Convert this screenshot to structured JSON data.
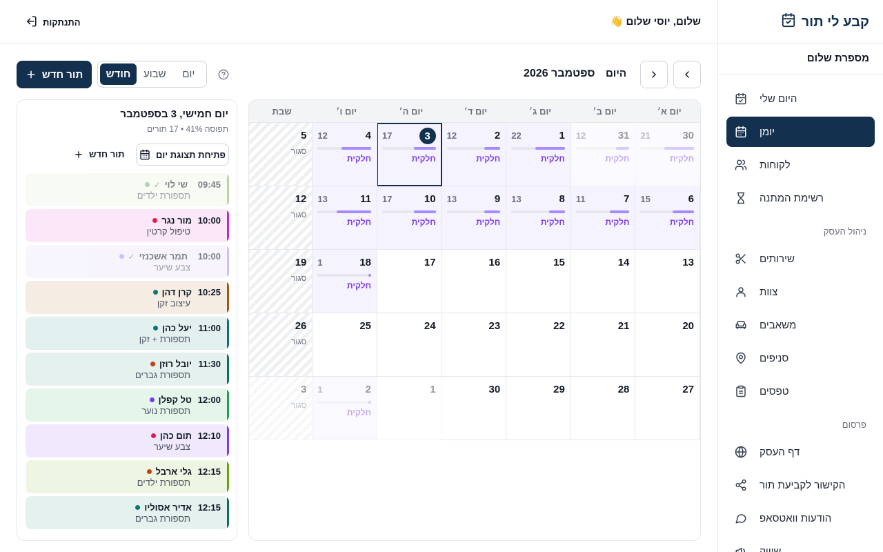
{
  "app": {
    "brand": "קבע לי תור",
    "salon_name": "מספרת שלום"
  },
  "header": {
    "greeting": "שלום, יוסי שלום 👋",
    "logout": "התנתקות"
  },
  "sidebar": {
    "items": [
      {
        "label": "היום שלי",
        "icon": "calendar-check-icon"
      },
      {
        "label": "יומן",
        "icon": "calendar-icon",
        "active": true
      },
      {
        "label": "לקוחות",
        "icon": "users-icon"
      },
      {
        "label": "רשימת המתנה",
        "icon": "hourglass-icon"
      }
    ],
    "section_business": "ניהול העסק",
    "business_items": [
      {
        "label": "שירותים",
        "icon": "scissors-icon"
      },
      {
        "label": "צוות",
        "icon": "user-icon"
      },
      {
        "label": "משאבים",
        "icon": "sofa-icon"
      },
      {
        "label": "סניפים",
        "icon": "map-pin-icon"
      },
      {
        "label": "טפסים",
        "icon": "clipboard-icon"
      }
    ],
    "section_publish": "פרסום",
    "publish_items": [
      {
        "label": "דף העסק",
        "icon": "globe-icon"
      },
      {
        "label": "הקישור לקביעת תור",
        "icon": "share-icon"
      },
      {
        "label": "הודעות וואטסאפ",
        "icon": "message-icon"
      },
      {
        "label": "שיווק",
        "icon": "megaphone-icon"
      }
    ]
  },
  "toolbar": {
    "today": "היום",
    "month_title": "ספטמבר 2026",
    "views": {
      "day": "יום",
      "week": "שבוע",
      "month": "חודש"
    },
    "active_view": "month",
    "new_appointment": "תור חדש"
  },
  "calendar": {
    "weekdays": [
      "יום א׳",
      "יום ב׳",
      "יום ג׳",
      "יום ד׳",
      "יום ה׳",
      "יום ו׳",
      "שבת"
    ],
    "partial_label": "חלקית",
    "closed_label": "סגור",
    "weeks": [
      [
        {
          "day": "30",
          "count": "21",
          "occupancy": 0.55,
          "partial": true,
          "other_month": true
        },
        {
          "day": "31",
          "count": "12",
          "occupancy": 0.25,
          "partial": true,
          "other_month": true
        },
        {
          "day": "1",
          "count": "22",
          "occupancy": 0.55,
          "partial": true
        },
        {
          "day": "2",
          "count": "12",
          "occupancy": 0.3,
          "partial": true
        },
        {
          "day": "3",
          "count": "17",
          "occupancy": 0.41,
          "partial": true,
          "today": true
        },
        {
          "day": "4",
          "count": "12",
          "occupancy": 0.55,
          "partial": true
        },
        {
          "day": "5",
          "closed": true
        }
      ],
      [
        {
          "day": "6",
          "count": "15",
          "occupancy": 0.4,
          "partial": true
        },
        {
          "day": "7",
          "count": "11",
          "occupancy": 0.36,
          "partial": true
        },
        {
          "day": "8",
          "count": "13",
          "occupancy": 0.3,
          "partial": true
        },
        {
          "day": "9",
          "count": "13",
          "occupancy": 0.3,
          "partial": true
        },
        {
          "day": "10",
          "count": "17",
          "occupancy": 0.41,
          "partial": true
        },
        {
          "day": "11",
          "count": "13",
          "occupancy": 0.65,
          "partial": true
        },
        {
          "day": "12",
          "closed": true
        }
      ],
      [
        {
          "day": "13"
        },
        {
          "day": "14"
        },
        {
          "day": "15"
        },
        {
          "day": "16"
        },
        {
          "day": "17"
        },
        {
          "day": "18",
          "count": "1",
          "occupancy": 0.05,
          "partial": true
        },
        {
          "day": "19",
          "closed": true
        }
      ],
      [
        {
          "day": "20"
        },
        {
          "day": "21"
        },
        {
          "day": "22"
        },
        {
          "day": "23"
        },
        {
          "day": "24"
        },
        {
          "day": "25"
        },
        {
          "day": "26",
          "closed": true
        }
      ],
      [
        {
          "day": "27"
        },
        {
          "day": "28"
        },
        {
          "day": "29"
        },
        {
          "day": "30"
        },
        {
          "day": "1",
          "other_month": true
        },
        {
          "day": "2",
          "count": "1",
          "occupancy": 0.05,
          "partial": true,
          "other_month": true
        },
        {
          "day": "3",
          "closed": true,
          "other_month": true
        }
      ]
    ]
  },
  "day_panel": {
    "title": "יום חמישי, 3 בספטמבר",
    "subtitle": "תפוסה 41% • 17 תורים",
    "open_day_view": "פתיחת תצוגת יום",
    "new_appointment": "תור חדש",
    "appointments": [
      {
        "time": "09:45",
        "name": "שי לוי",
        "service": "תספורת ילדים",
        "color": "#86b05a",
        "bg": "#f3f8ec",
        "done": true
      },
      {
        "time": "10:00",
        "name": "מור נגר",
        "service": "טיפול קרטין",
        "color": "#c026d3",
        "bg": "#fbe7f8",
        "done": false
      },
      {
        "time": "10:00",
        "name": "תמר אשכנזי",
        "service": "צבע שיער",
        "color": "#a78bfa",
        "bg": "#f1ecfd",
        "done": true
      },
      {
        "time": "10:25",
        "name": "קרן דהן",
        "service": "עיצוב זקן",
        "color": "#9a5a14",
        "bg": "#f5ede3",
        "done": false
      },
      {
        "time": "11:00",
        "name": "יעל כהן",
        "service": "תספורת + זקן",
        "color": "#0e6e70",
        "bg": "#e3f0f0",
        "done": false
      },
      {
        "time": "11:30",
        "name": "יובל רוזן",
        "service": "תספורת גברים",
        "color": "#0f6b5c",
        "bg": "#e5f1ee",
        "done": false
      },
      {
        "time": "12:00",
        "name": "טל קפלן",
        "service": "תספורת נוער",
        "color": "#1f9d55",
        "bg": "#e4f6ea",
        "done": false
      },
      {
        "time": "12:10",
        "name": "תום כהן",
        "service": "צבע שיער",
        "color": "#7c3aed",
        "bg": "#f0e9fd",
        "done": false
      },
      {
        "time": "12:15",
        "name": "גלי ארבל",
        "service": "תספורת ילדים",
        "color": "#65a30d",
        "bg": "#eef6e3",
        "done": false
      },
      {
        "time": "12:15",
        "name": "אדיר אסוליו",
        "service": "תספורת גברים",
        "color": "#0f6b5c",
        "bg": "#e5f1ee",
        "done": false
      }
    ],
    "dot_colors": [
      "#65b17a",
      "#e11d48",
      "#a78bfa",
      "#0f766e",
      "#0f766e",
      "#c2410c",
      "#7c3aed",
      "#e11d48",
      "#c2410c",
      "#0f766e"
    ]
  }
}
